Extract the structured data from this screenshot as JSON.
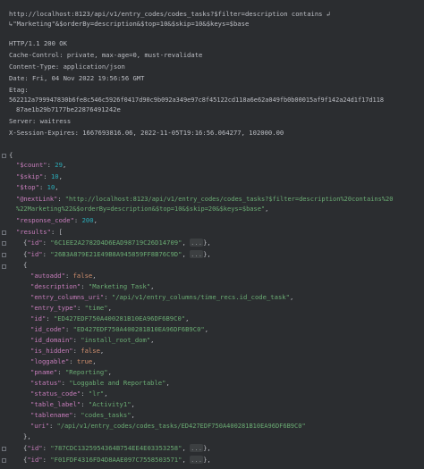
{
  "request": {
    "line1": "http://localhost:8123/api/v1/entry_codes/codes_tasks?$filter=description contains ↲",
    "line2": "↳\"Marketing\"&$orderBy=description&$top=10&$skip=10&$keys=$base"
  },
  "headers": {
    "status": "HTTP/1.1 200 OK",
    "cache": "Cache-Control: private, max-age=0, must-revalidate",
    "content_type": "Content-Type: application/json",
    "date": "Date: Fri, 04 Nov 2022 19:56:56 GMT",
    "etag_label": "Etag:",
    "etag_1": "562212a799947830b6fe8c546c5926f0417d90c9b092a349e97c8f45122cd118a6e62a049fb0b00015af9f142a24d1f17d118",
    "etag_2": "87ae1b29b7177be22876491242e",
    "server": "Server: waitress",
    "session": "X-Session-Expires: 1667693816.06, 2022-11-05T19:16:56.064277, 102000.00"
  },
  "body": {
    "open_brace": "{",
    "count_key": "\"$count\"",
    "count_val": "29",
    "skip_key": "\"$skip\"",
    "skip_val": "10",
    "top_key": "\"$top\"",
    "top_val": "10",
    "nextlink_key": "\"@nextLink\"",
    "nextlink_val_1": "\"http://localhost:8123/api/v1/entry_codes/codes_tasks?$filter=description%20contains%20",
    "nextlink_val_2": "%22Marketing%22&$orderBy=description&$top=10&$skip=20&$keys=$base\"",
    "response_code_key": "\"response_code\"",
    "response_code_val": "200",
    "results_key": "\"results\"",
    "results_open": "[",
    "collapsed_1_key": "\"id\"",
    "collapsed_1_val": "\"6C1EE2A2782D4D6EAD98719C26D14709\"",
    "collapsed_2_key": "\"id\"",
    "collapsed_2_val": "\"26B3A879E21E49B8A945859FF8B76C9D\"",
    "ellipsis": "...",
    "expanded": {
      "autoadd_key": "\"autoadd\"",
      "autoadd_val": "false",
      "description_key": "\"description\"",
      "description_val": "\"Marketing Task\"",
      "entry_columns_uri_key": "\"entry_columns_uri\"",
      "entry_columns_uri_val": "\"/api/v1/entry_columns/time_recs.id_code_task\"",
      "entry_type_key": "\"entry_type\"",
      "entry_type_val": "\"time\"",
      "id_key": "\"id\"",
      "id_val": "\"ED427EDF750A400281B10EA96DF6B9C0\"",
      "id_code_key": "\"id_code\"",
      "id_code_val": "\"ED427EDF750A400281B10EA96DF6B9C0\"",
      "id_domain_key": "\"id_domain\"",
      "id_domain_val": "\"install_root_dom\"",
      "is_hidden_key": "\"is_hidden\"",
      "is_hidden_val": "false",
      "loggable_key": "\"loggable\"",
      "loggable_val": "true",
      "pname_key": "\"pname\"",
      "pname_val": "\"Reporting\"",
      "status_key": "\"status\"",
      "status_val": "\"Loggable and Reportable\"",
      "status_code_key": "\"status_code\"",
      "status_code_val": "\"lr\"",
      "table_label_key": "\"table_label\"",
      "table_label_val": "\"Activity1\"",
      "tablename_key": "\"tablename\"",
      "tablename_val": "\"codes_tasks\"",
      "uri_key": "\"uri\"",
      "uri_val": "\"/api/v1/entry_codes/codes_tasks/ED427EDF750A400281B10EA96DF6B9C0\""
    },
    "close_obj": "},",
    "collapsed_3_key": "\"id\"",
    "collapsed_3_val": "\"787CDC1325954364B754EE4E03353258\"",
    "collapsed_4_key": "\"id\"",
    "collapsed_4_val": "\"F01FDF4316FD4D8AAE097C7558503571\""
  },
  "colors": {
    "background": "#2b2d30",
    "text": "#bcbec4",
    "string": "#6aab73",
    "key": "#c77dbb",
    "number": "#2aacb8",
    "keyword": "#cf8e6d"
  }
}
